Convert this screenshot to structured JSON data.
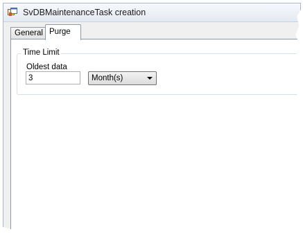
{
  "window": {
    "title": "SvDBMaintenanceTask creation",
    "icon": "app-window-icon"
  },
  "tabs": [
    {
      "label": "General",
      "selected": false
    },
    {
      "label": "Purge",
      "selected": true
    }
  ],
  "purge": {
    "group_title": "Time Limit",
    "oldest_data_label": "Oldest data",
    "oldest_data_value": "3",
    "unit_selected": "Month(s)"
  }
}
